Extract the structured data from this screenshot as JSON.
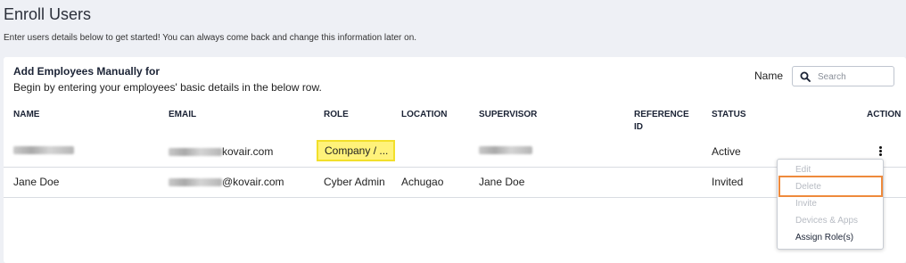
{
  "page": {
    "title": "Enroll Users",
    "subtitle": "Enter users details below to get started! You can always come back and change this information later on."
  },
  "card": {
    "title": "Add Employees Manually for",
    "description": "Begin by entering your employees' basic details in the below row.",
    "search_label": "Name",
    "search_placeholder": "Search"
  },
  "table": {
    "headers": {
      "name": "NAME",
      "email": "EMAIL",
      "role": "ROLE",
      "location": "LOCATION",
      "supervisor": "SUPERVISOR",
      "reference_id": "REFERENCE ID",
      "status": "STATUS",
      "action": "ACTION"
    },
    "rows": [
      {
        "name": "",
        "email_suffix": "kovair.com",
        "role": "Company / ...",
        "location": "",
        "supervisor": "",
        "status": "Active"
      },
      {
        "name": "Jane Doe",
        "email_suffix": "@kovair.com",
        "role": "Cyber Admin",
        "location": "Achugao",
        "supervisor": "Jane Doe",
        "status": "Invited"
      }
    ]
  },
  "action_menu": {
    "items": [
      {
        "label": "Edit",
        "enabled": false
      },
      {
        "label": "Delete",
        "enabled": false,
        "highlighted": true
      },
      {
        "label": "Invite",
        "enabled": false
      },
      {
        "label": "Devices & Apps",
        "enabled": false
      },
      {
        "label": "Assign Role(s)",
        "enabled": true
      }
    ]
  },
  "colors": {
    "role_highlight": "#fff27a",
    "delete_outline": "#ee8a3c",
    "background": "#eef0f5"
  }
}
